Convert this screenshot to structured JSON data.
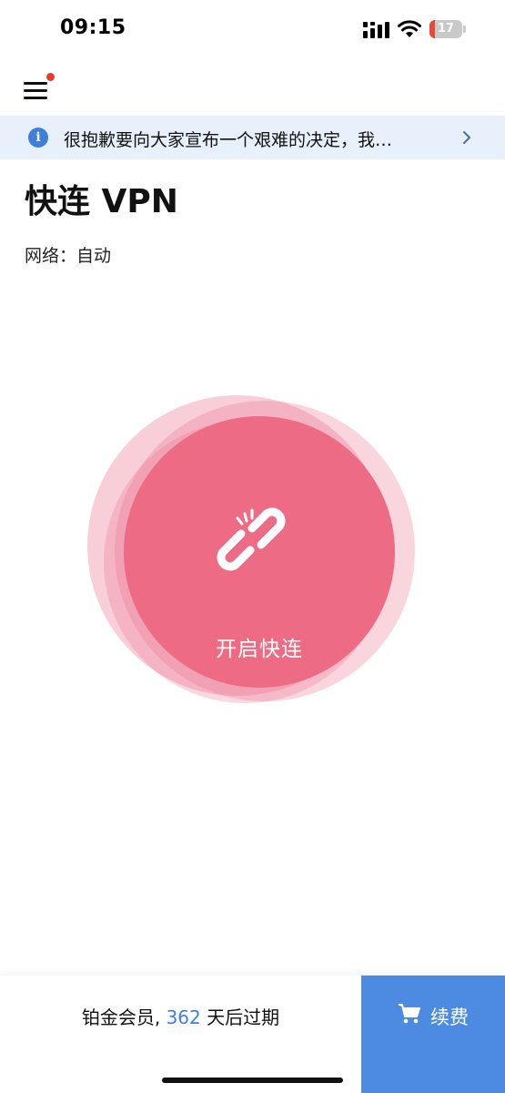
{
  "status_bar": {
    "time": "09:15",
    "battery_level": "17",
    "battery_fraction": 0.17,
    "battery_color": "#e24a3b",
    "icons": [
      "signal-icon",
      "wifi-icon",
      "battery-icon"
    ]
  },
  "header": {
    "menu_icon": "hamburger-menu-icon",
    "has_notification_dot": true,
    "notification_dot_color": "#e8382f"
  },
  "notice": {
    "icon": "info-icon",
    "icon_glyph": "i",
    "text": "很抱歉要向大家宣布一个艰难的决定，我…",
    "chevron_icon": "chevron-right-icon"
  },
  "title": "快连 VPN",
  "network": {
    "label": "网络：",
    "value": "自动"
  },
  "connect": {
    "label": "开启快连",
    "icon": "broken-link-icon",
    "color": "#ed6b84"
  },
  "footer": {
    "membership_prefix": "铂金会员,",
    "days": "362",
    "membership_suffix": "天后过期",
    "renew_icon": "cart-icon",
    "renew_label": "续费",
    "renew_color": "#4d8be3",
    "days_color": "#3f7fde"
  }
}
